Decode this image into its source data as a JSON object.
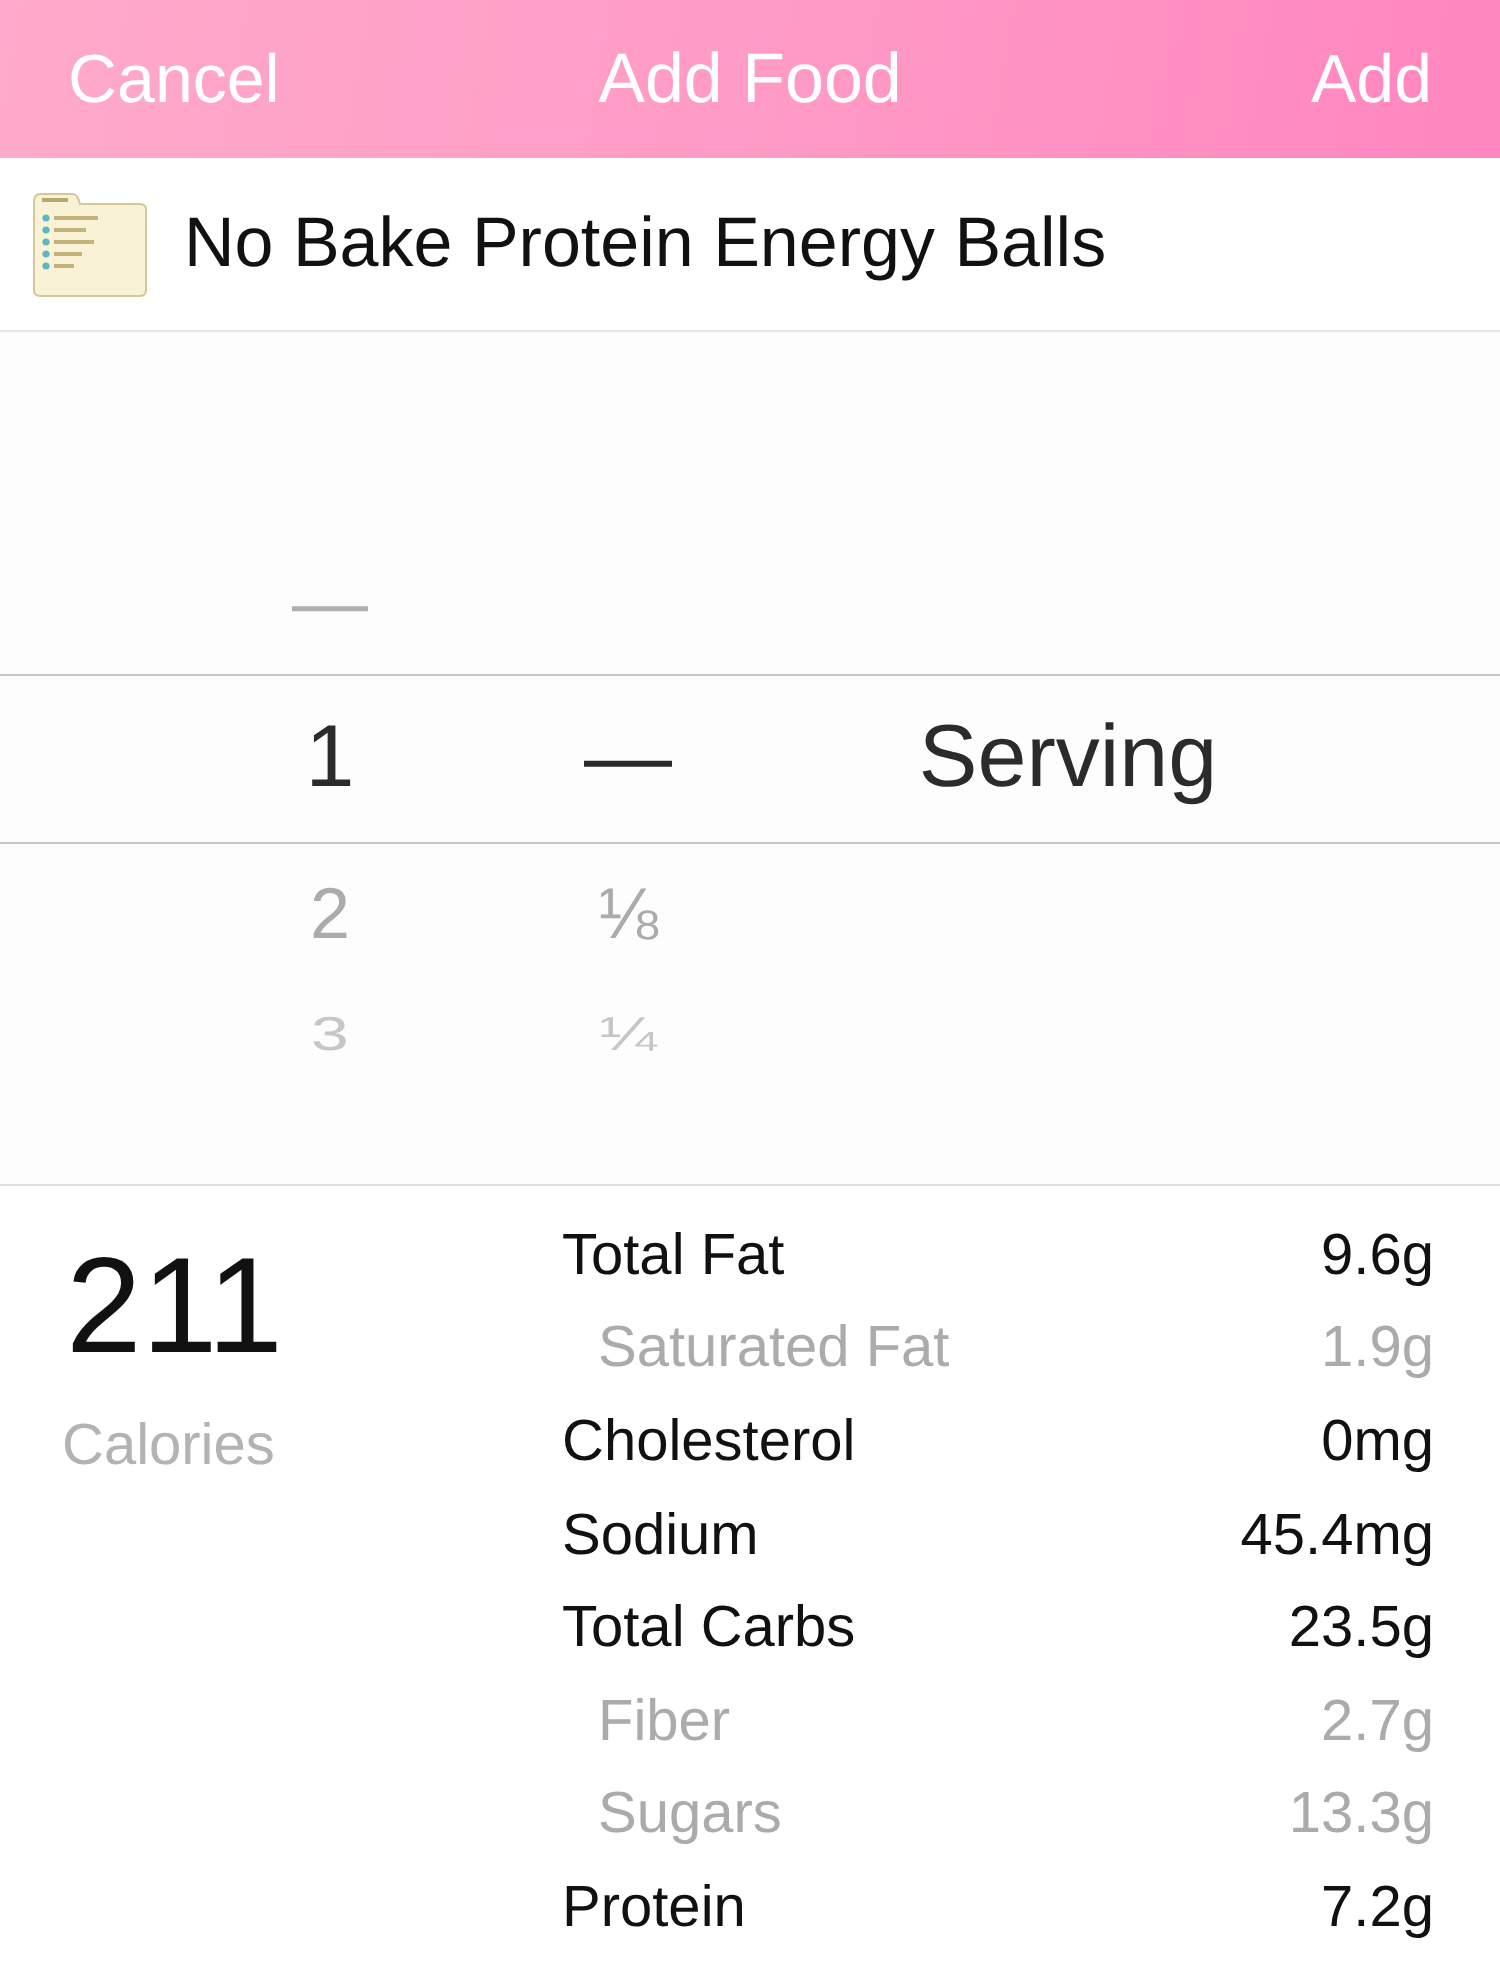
{
  "nav_bar": {
    "cancel": "Cancel",
    "title": "Add Food",
    "add": "Add"
  },
  "food": {
    "name": "No Bake Protein Energy Balls"
  },
  "picker": {
    "columns": [
      {
        "kind": "whole",
        "items": [
          {
            "label": "—",
            "selected": false
          },
          {
            "label": "1",
            "selected": true
          },
          {
            "label": "2",
            "selected": false
          },
          {
            "label": "3",
            "selected": false
          }
        ]
      },
      {
        "kind": "fraction",
        "items": [
          {
            "label": "—",
            "selected": true
          },
          {
            "label": "⅛",
            "selected": false
          },
          {
            "label": "¼",
            "selected": false
          }
        ]
      },
      {
        "kind": "unit",
        "items": [
          {
            "label": "Serving",
            "selected": true
          }
        ]
      }
    ]
  },
  "calories": {
    "value": "211",
    "label": "Calories"
  },
  "nutrients": [
    {
      "kind": "main",
      "label": "Total Fat",
      "value": "9.6g"
    },
    {
      "kind": "sub",
      "label": "Saturated Fat",
      "value": "1.9g"
    },
    {
      "kind": "main",
      "label": "Cholesterol",
      "value": "0mg"
    },
    {
      "kind": "main",
      "label": "Sodium",
      "value": "45.4mg"
    },
    {
      "kind": "main",
      "label": "Total Carbs",
      "value": "23.5g"
    },
    {
      "kind": "sub",
      "label": "Fiber",
      "value": "2.7g"
    },
    {
      "kind": "sub",
      "label": "Sugars",
      "value": "13.3g"
    },
    {
      "kind": "main",
      "label": "Protein",
      "value": "7.2g"
    }
  ]
}
